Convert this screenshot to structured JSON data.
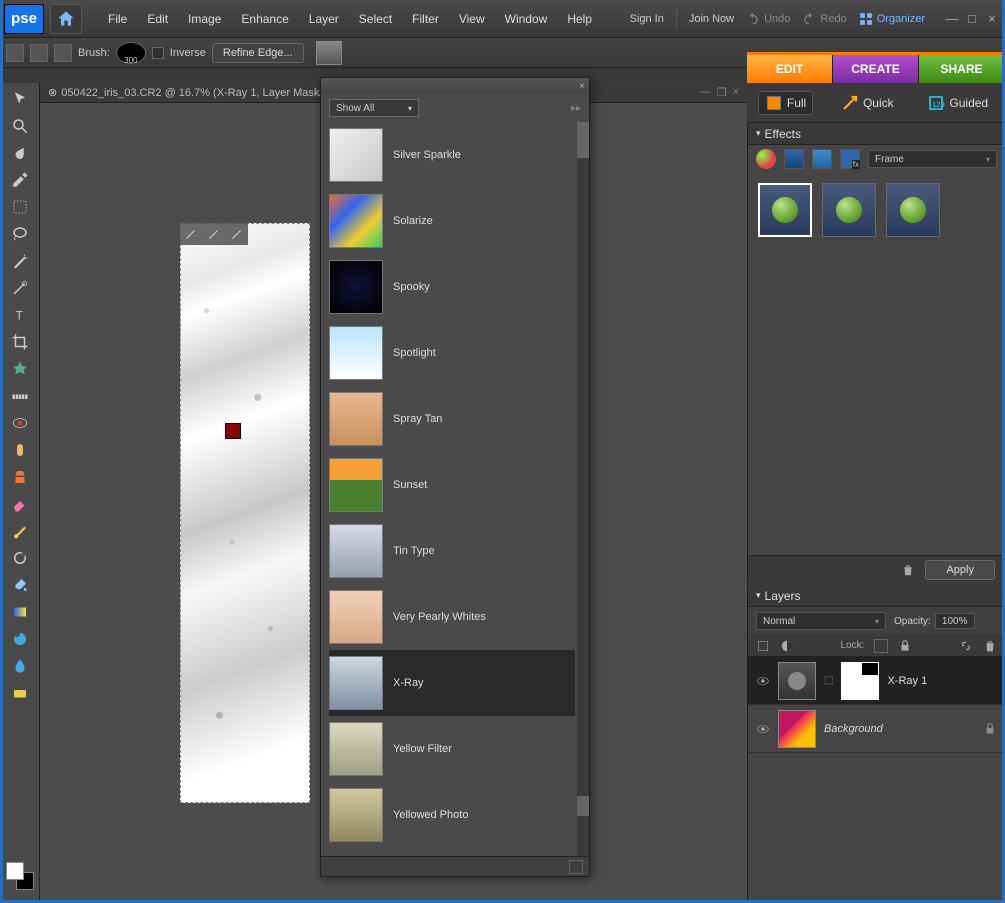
{
  "app": {
    "logo": "pse"
  },
  "menu": {
    "file": "File",
    "edit": "Edit",
    "image": "Image",
    "enhance": "Enhance",
    "layer": "Layer",
    "select": "Select",
    "filter": "Filter",
    "view": "View",
    "window": "Window",
    "help": "Help"
  },
  "account": {
    "sign_in": "Sign In",
    "join_now": "Join Now"
  },
  "history": {
    "undo": "Undo",
    "redo": "Redo"
  },
  "organizer": {
    "label": "Organizer"
  },
  "options": {
    "brush_label": "Brush:",
    "brush_size": "300",
    "inverse_label": "Inverse",
    "refine_label": "Refine Edge..."
  },
  "modes": {
    "edit": "EDIT",
    "create": "CREATE",
    "share": "SHARE"
  },
  "edit_tabs": {
    "full": "Full",
    "quick": "Quick",
    "guided": "Guided"
  },
  "effects": {
    "title": "Effects",
    "category": "Frame",
    "apply": "Apply"
  },
  "layers": {
    "title": "Layers",
    "blend_mode": "Normal",
    "opacity_label": "Opacity:",
    "opacity_value": "100%",
    "lock_label": "Lock:",
    "rows": [
      {
        "name": "X-Ray 1",
        "italic": false,
        "locked": false
      },
      {
        "name": "Background",
        "italic": true,
        "locked": true
      }
    ]
  },
  "document": {
    "title": "050422_iris_03.CR2 @ 16.7% (X-Ray 1, Layer Mask/8)"
  },
  "fx_popup": {
    "filter": "Show All",
    "items": [
      {
        "label": "Silver Sparkle",
        "thumb": "th-sparkle"
      },
      {
        "label": "Solarize",
        "thumb": "th-solarize"
      },
      {
        "label": "Spooky",
        "thumb": "th-spooky"
      },
      {
        "label": "Spotlight",
        "thumb": "th-spot"
      },
      {
        "label": "Spray Tan",
        "thumb": "th-tan"
      },
      {
        "label": "Sunset",
        "thumb": "th-sunset"
      },
      {
        "label": "Tin Type",
        "thumb": "th-tin"
      },
      {
        "label": "Very Pearly Whites",
        "thumb": "th-pearly"
      },
      {
        "label": "X-Ray",
        "thumb": "th-xray",
        "selected": true
      },
      {
        "label": "Yellow Filter",
        "thumb": "th-yellow"
      },
      {
        "label": "Yellowed Photo",
        "thumb": "th-yellowed"
      }
    ]
  }
}
